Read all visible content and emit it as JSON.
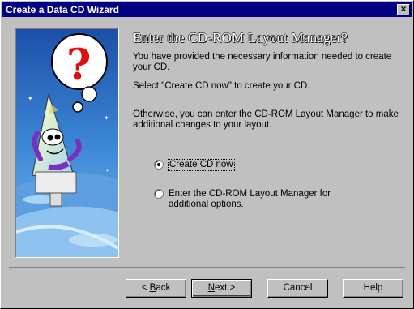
{
  "window": {
    "title": "Create a Data CD Wizard",
    "close_glyph": "×"
  },
  "heading": "Enter the CD-ROM Layout Manager?",
  "paragraphs": [
    "You have provided the necessary information needed to create your CD.",
    "Select \"Create CD now\" to create your CD.",
    "Otherwise, you can enter the CD-ROM Layout Manager to make additional changes to your layout."
  ],
  "options": [
    {
      "label": "Create CD now",
      "selected": true
    },
    {
      "label_line1": "Enter the CD-ROM Layout Manager for",
      "label_line2": "additional options.",
      "selected": false
    }
  ],
  "buttons": {
    "back_prefix": "< ",
    "back_mnemonic": "B",
    "back_rest": "ack",
    "next_mnemonic": "N",
    "next_rest": "ext >",
    "cancel": "Cancel",
    "help": "Help"
  },
  "colors": {
    "titlebar": "#000080",
    "face": "#c0c0c0",
    "illustration_sky": "#3a7fd0"
  }
}
